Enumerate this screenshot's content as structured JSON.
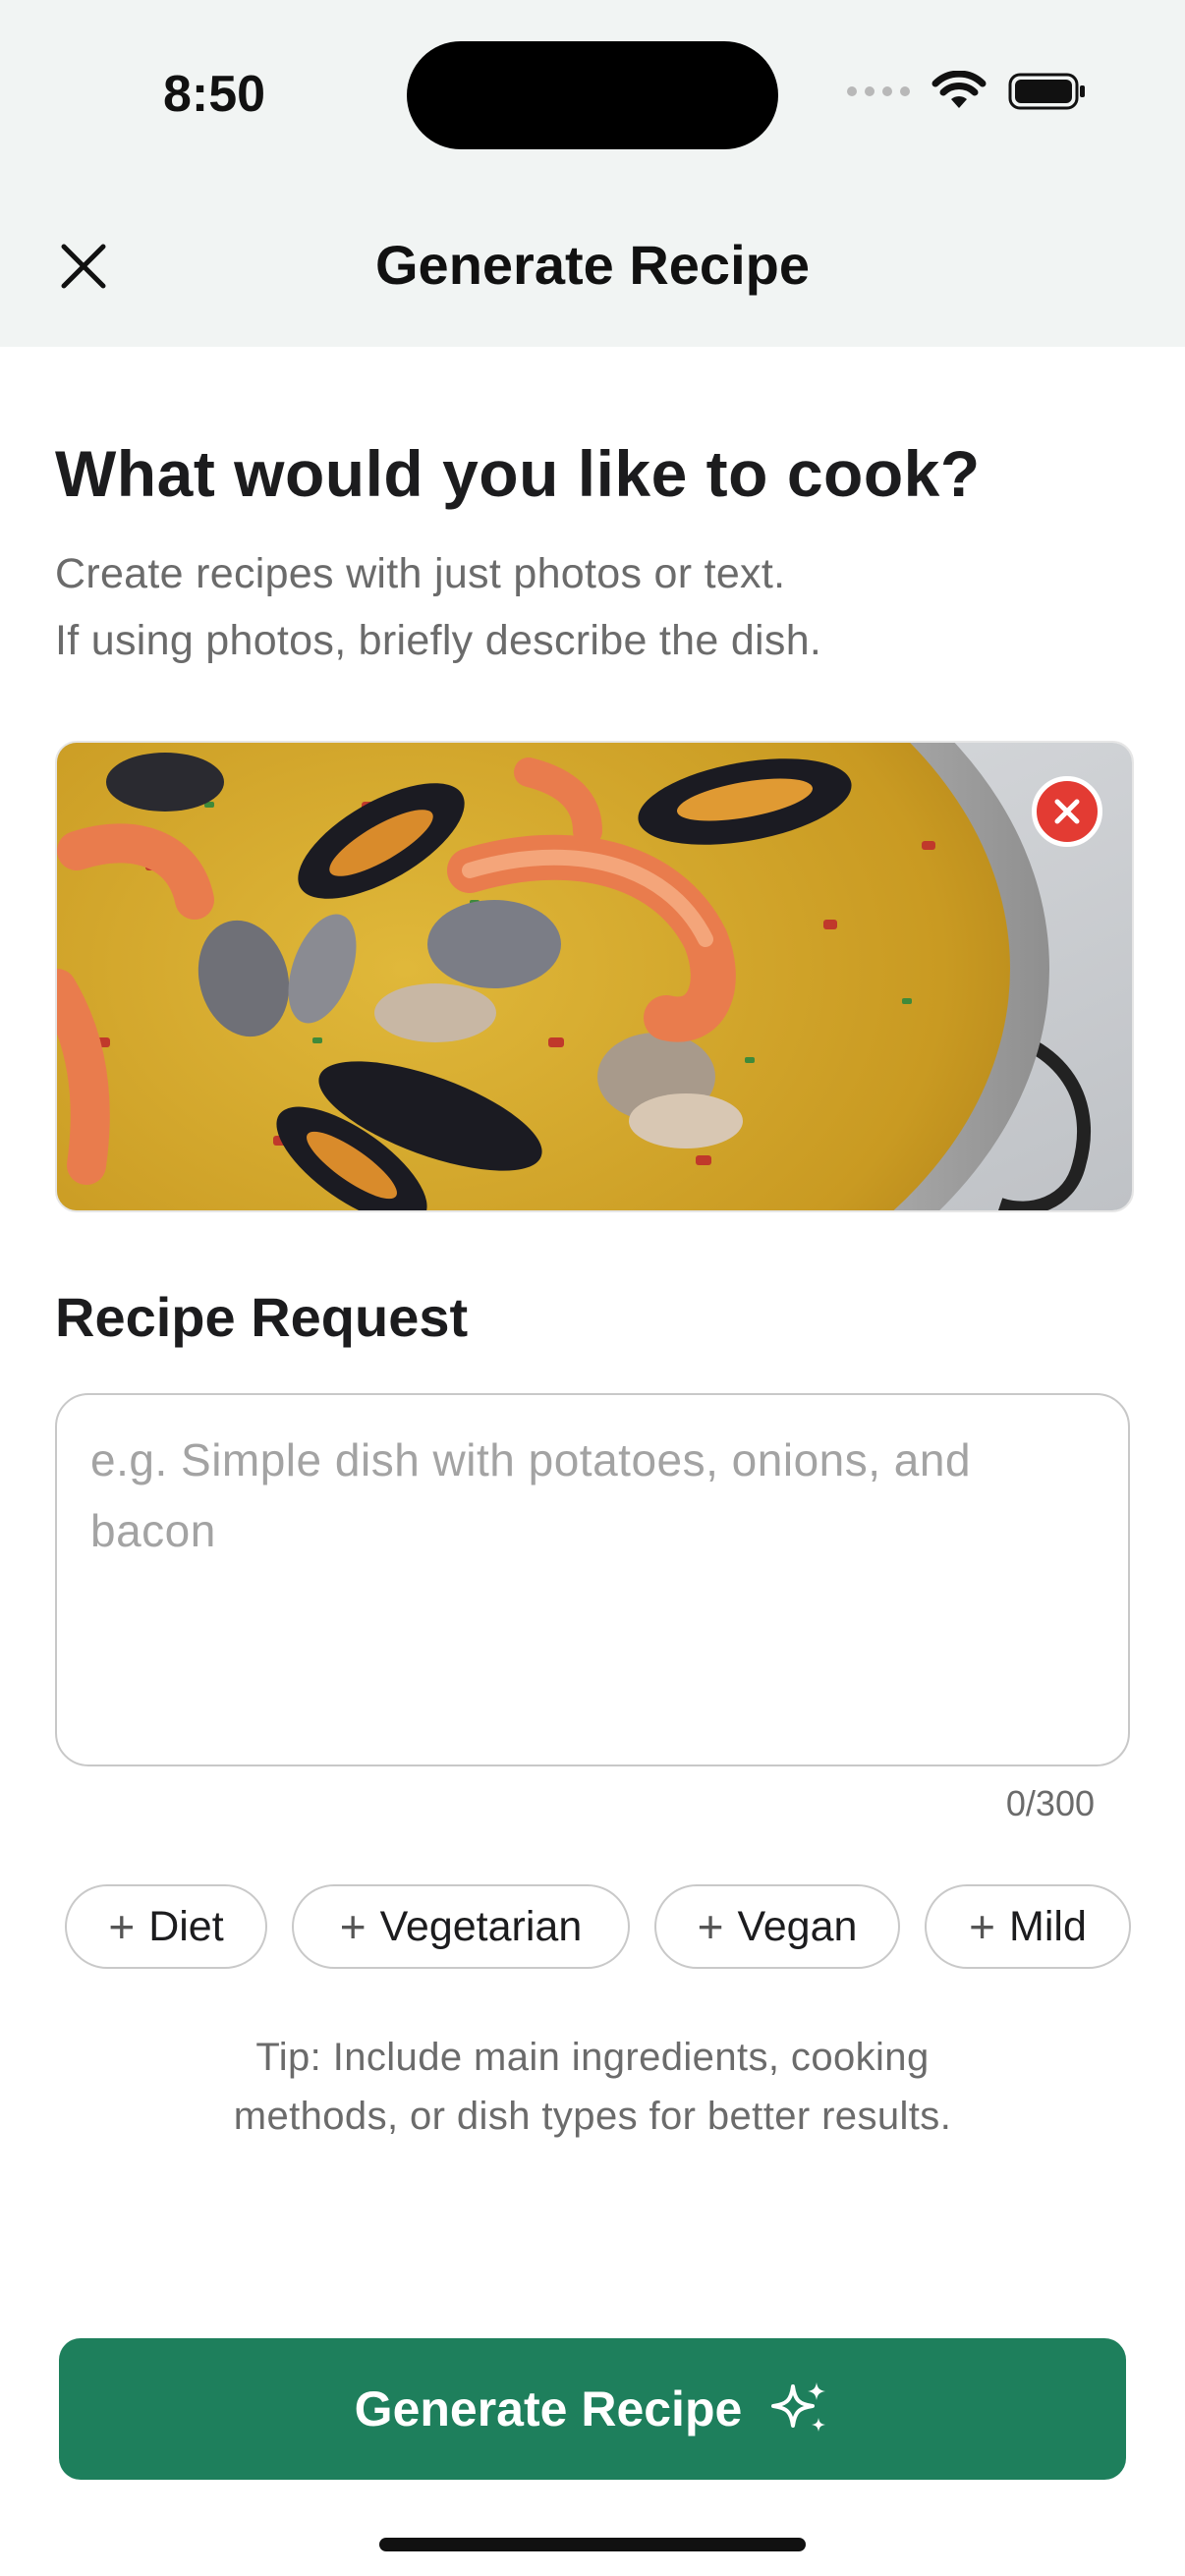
{
  "status_bar": {
    "time": "8:50"
  },
  "nav": {
    "title": "Generate Recipe",
    "close_icon": "close-icon"
  },
  "intro": {
    "heading": "What would you like to cook?",
    "subtitle_line1": "Create recipes with just photos or text.",
    "subtitle_line2": "If using photos, briefly describe the dish."
  },
  "photo": {
    "remove_icon": "remove-photo-icon",
    "remove_color": "#e33b33"
  },
  "request": {
    "section_title": "Recipe Request",
    "placeholder": "e.g. Simple dish with potatoes, onions, and bacon",
    "counter": "0/300"
  },
  "chips": [
    {
      "label": "Diet"
    },
    {
      "label": "Vegetarian"
    },
    {
      "label": "Vegan"
    },
    {
      "label": "Mild"
    }
  ],
  "tip": {
    "line1": "Tip: Include main ingredients, cooking",
    "line2": "methods, or dish types for better results."
  },
  "cta": {
    "label": "Generate Recipe",
    "icon": "sparkle-icon",
    "color": "#1e7f5c"
  }
}
